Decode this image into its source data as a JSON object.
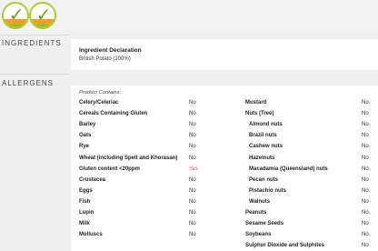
{
  "header": {
    "badges": [
      "vegan-badge-icon",
      "vegetarian-badge-icon"
    ]
  },
  "ingredients": {
    "section_label": "INGREDIENTS",
    "title": "Ingredient Declaration",
    "text": "British Potato (100%)"
  },
  "allergens": {
    "section_label": "ALLERGENS",
    "product_contains_label": "Product Contains:",
    "left": [
      {
        "name": "Celery/Celeriac",
        "value": "No"
      },
      {
        "name": "Cereals Containing Gluten",
        "value": "No"
      },
      {
        "name": "Barley",
        "value": "No"
      },
      {
        "name": "Oats",
        "value": "No"
      },
      {
        "name": "Rye",
        "value": "No"
      },
      {
        "name": "Wheat (including Spelt and Khorasan)",
        "value": "No"
      },
      {
        "name": "Gluten content <20ppm",
        "value": "Yes"
      },
      {
        "name": "Crustacea",
        "value": "No"
      },
      {
        "name": "Eggs",
        "value": "No"
      },
      {
        "name": "Fish",
        "value": "No"
      },
      {
        "name": "Lupin",
        "value": "No"
      },
      {
        "name": "Milk",
        "value": "No"
      },
      {
        "name": "Molluscs",
        "value": "No"
      }
    ],
    "right": [
      {
        "name": "Mustard",
        "value": "No"
      },
      {
        "name": "Nuts (Tree)",
        "value": "No"
      },
      {
        "name": "Almond nuts",
        "value": "No"
      },
      {
        "name": "Brazil nuts",
        "value": "No"
      },
      {
        "name": "Cashew nuts",
        "value": "No"
      },
      {
        "name": "Hazelnuts",
        "value": "No"
      },
      {
        "name": "Macadamia (Queensland) nuts",
        "value": "No"
      },
      {
        "name": "Pecan nuts",
        "value": "No"
      },
      {
        "name": "Pistachio nuts",
        "value": "No"
      },
      {
        "name": "Walnuts",
        "value": "No"
      },
      {
        "name": "Peanuts",
        "value": "No"
      },
      {
        "name": "Sesame Seeds",
        "value": "No"
      },
      {
        "name": "Soybeans",
        "value": "No"
      },
      {
        "name": "Sulphur Dioxide and Sulphites",
        "value": "No"
      }
    ]
  }
}
